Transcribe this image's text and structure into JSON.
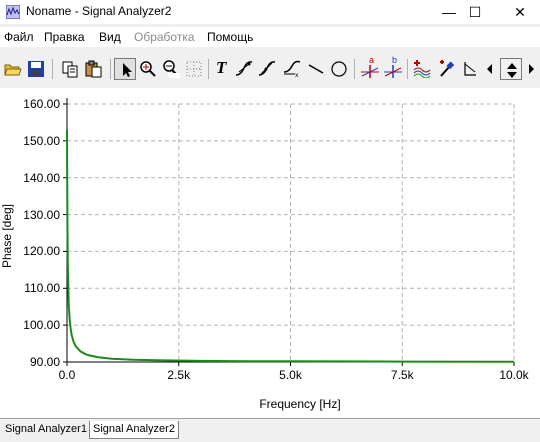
{
  "window": {
    "title": "Noname - Signal Analyzer2",
    "minimize_glyph": "—",
    "maximize_glyph": "☐",
    "close_glyph": "✕"
  },
  "menu": {
    "items": [
      {
        "label": "Файл",
        "enabled": true
      },
      {
        "label": "Правка",
        "enabled": true
      },
      {
        "label": "Вид",
        "enabled": true
      },
      {
        "label": "Обработка",
        "enabled": false
      },
      {
        "label": "Помощь",
        "enabled": true
      }
    ]
  },
  "toolbar": {
    "icons": [
      "open-folder-icon",
      "save-icon",
      "copy-icon",
      "paste-icon",
      "pointer-icon",
      "zoom-in-icon",
      "zoom-100-icon",
      "grid-select-icon",
      "text-icon",
      "marker-a-icon",
      "marker-b-icon",
      "marker-x-icon",
      "line-icon",
      "circle-icon",
      "cursor-a-icon",
      "cursor-b-icon",
      "add-trace-icon",
      "pipette-icon",
      "step-icon",
      "scroll-left-icon",
      "scroll-updown-icon",
      "scroll-right-icon"
    ],
    "text_tool_glyph": "T",
    "cursor_a_label": "a",
    "cursor_b_label": "b"
  },
  "chart_data": {
    "type": "line",
    "xlabel": "Frequency [Hz]",
    "ylabel": "Phase [deg]",
    "xlim": [
      0,
      10000
    ],
    "ylim": [
      90,
      160
    ],
    "x_ticks": [
      0,
      2500,
      5000,
      7500,
      10000
    ],
    "x_tick_labels": [
      "0.0",
      "2.5k",
      "5.0k",
      "7.5k",
      "10.0k"
    ],
    "y_ticks": [
      90,
      100,
      110,
      120,
      130,
      140,
      150,
      160
    ],
    "y_tick_labels": [
      "90.00",
      "100.00",
      "110.00",
      "120.00",
      "130.00",
      "140.00",
      "150.00",
      "160.00"
    ],
    "grid": true,
    "series": [
      {
        "color": "#1a8a1a",
        "x": [
          0,
          10,
          20,
          40,
          60,
          80,
          100,
          150,
          200,
          300,
          400,
          500,
          700,
          1000,
          1500,
          2000,
          3000,
          4000,
          5000,
          7500,
          10000
        ],
        "y": [
          153,
          128,
          115,
          105,
          101.5,
          99.2,
          97.5,
          95.4,
          94.2,
          92.9,
          92.2,
          91.8,
          91.3,
          90.9,
          90.6,
          90.45,
          90.3,
          90.22,
          90.18,
          90.12,
          90.09
        ]
      }
    ]
  },
  "tabs": [
    {
      "label": "Signal Analyzer1",
      "active": false
    },
    {
      "label": "Signal Analyzer2",
      "active": true
    }
  ]
}
